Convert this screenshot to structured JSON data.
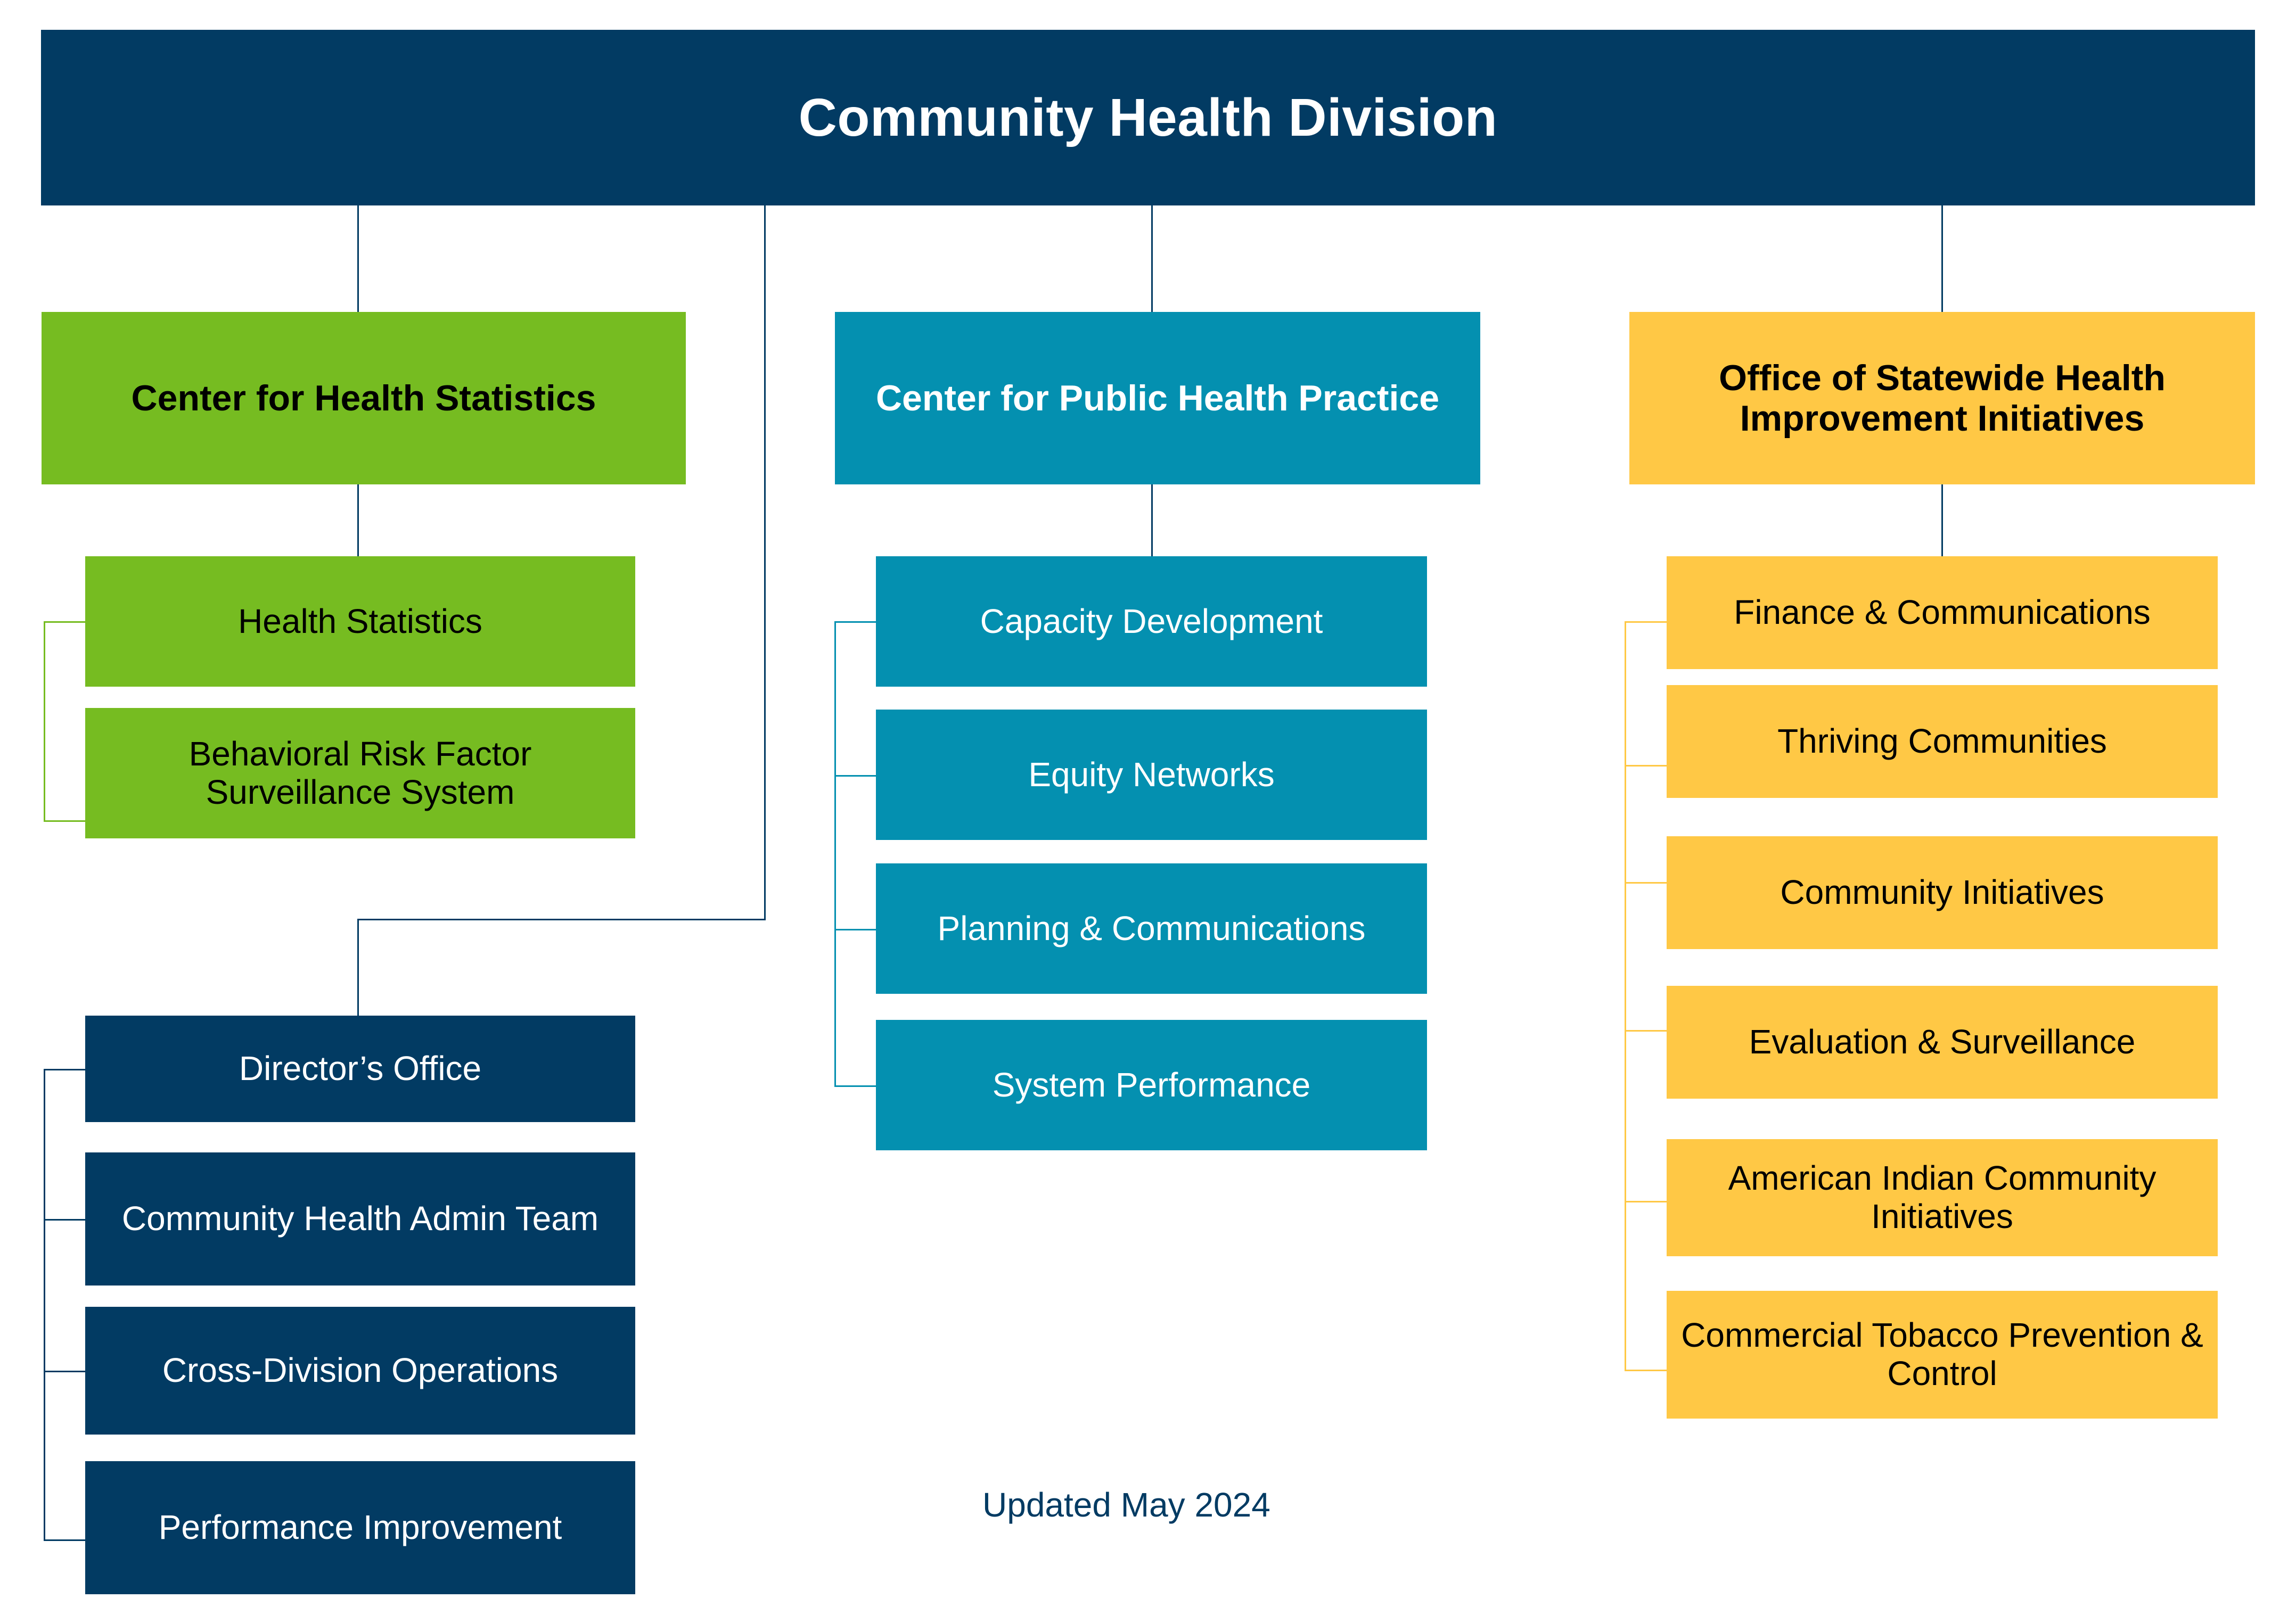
{
  "chart_type": "org-chart",
  "title": "Community Health Division",
  "footer": "Updated May 2024",
  "colors": {
    "navy": "#023B63",
    "green": "#76BC21",
    "teal": "#0490B0",
    "yellow": "#FFC845",
    "white": "#FFFFFF",
    "black": "#000000"
  },
  "columns": [
    {
      "id": "center-health-statistics",
      "header": "Center for Health Statistics",
      "color": "green",
      "children": [
        "Health Statistics",
        "Behavioral Risk Factor Surveillance System"
      ]
    },
    {
      "id": "center-public-health-practice",
      "header": "Center for Public Health Practice",
      "color": "teal",
      "children": [
        "Capacity Development",
        "Equity Networks",
        "Planning & Communications",
        "System Performance"
      ]
    },
    {
      "id": "office-statewide-health-improvement",
      "header": "Office of Statewide Health Improvement Initiatives",
      "color": "yellow",
      "children": [
        "Finance & Communications",
        "Thriving Communities",
        "Community Initiatives",
        "Evaluation & Surveillance",
        "American Indian Community Initiatives",
        "Commercial Tobacco Prevention & Control"
      ]
    }
  ],
  "division_office_group": {
    "id": "division-office",
    "color": "navy",
    "children": [
      "Director’s Office",
      "Community Health Admin Team",
      "Cross-Division Operations",
      "Performance Improvement"
    ]
  }
}
